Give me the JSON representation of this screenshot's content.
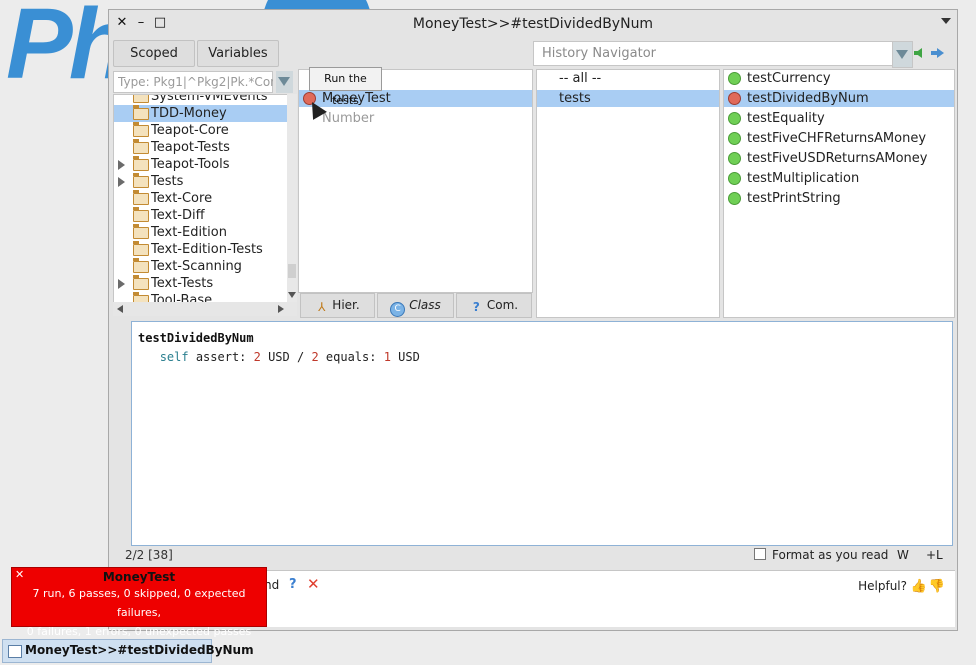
{
  "window": {
    "title": "MoneyTest>>#testDividedByNum"
  },
  "toolbar": {
    "scoped": "Scoped",
    "variables": "Variables",
    "history_placeholder": "History Navigator"
  },
  "package_filter": {
    "placeholder": "Type: Pkg1|^Pkg2|Pk.*Core$"
  },
  "packages": [
    {
      "label": "System-VMEvents",
      "expandable": false,
      "selected": false
    },
    {
      "label": "TDD-Money",
      "expandable": false,
      "selected": true
    },
    {
      "label": "Teapot-Core",
      "expandable": false,
      "selected": false
    },
    {
      "label": "Teapot-Tests",
      "expandable": false,
      "selected": false
    },
    {
      "label": "Teapot-Tools",
      "expandable": true,
      "selected": false
    },
    {
      "label": "Tests",
      "expandable": true,
      "selected": false
    },
    {
      "label": "Text-Core",
      "expandable": false,
      "selected": false
    },
    {
      "label": "Text-Diff",
      "expandable": false,
      "selected": false
    },
    {
      "label": "Text-Edition",
      "expandable": false,
      "selected": false
    },
    {
      "label": "Text-Edition-Tests",
      "expandable": false,
      "selected": false
    },
    {
      "label": "Text-Scanning",
      "expandable": false,
      "selected": false
    },
    {
      "label": "Text-Tests",
      "expandable": true,
      "selected": false
    },
    {
      "label": "Tool-Base",
      "expandable": false,
      "selected": false
    }
  ],
  "classes": [
    {
      "label": "MoneyTest",
      "status": "red",
      "selected": true
    },
    {
      "label": "Number",
      "status": "none",
      "selected": false
    }
  ],
  "tooltip": "Run the tests",
  "class_buttons": {
    "hier": "Hier.",
    "class": "Class",
    "com": "Com."
  },
  "protocols": [
    {
      "label": "-- all --",
      "selected": false
    },
    {
      "label": "tests",
      "selected": true
    }
  ],
  "methods": [
    {
      "label": "testCurrency",
      "status": "green",
      "selected": false
    },
    {
      "label": "testDividedByNum",
      "status": "red",
      "selected": true
    },
    {
      "label": "testEquality",
      "status": "green",
      "selected": false
    },
    {
      "label": "testFiveCHFReturnsAMoney",
      "status": "green",
      "selected": false
    },
    {
      "label": "testFiveUSDReturnsAMoney",
      "status": "green",
      "selected": false
    },
    {
      "label": "testMultiplication",
      "status": "green",
      "selected": false
    },
    {
      "label": "testPrintString",
      "status": "green",
      "selected": false
    }
  ],
  "editor": {
    "method_name": "testDividedByNum",
    "line2": {
      "self": "self",
      "assert": " assert: ",
      "n1": "2",
      "usd1": " USD / ",
      "n2": "2",
      "equals": " equals: ",
      "n3": "1",
      "usd2": " USD"
    }
  },
  "statusbar": {
    "position": "2/2 [38]",
    "format": "Format as you read",
    "w": "W",
    "l": "+L"
  },
  "help": {
    "partial": "nd",
    "question": "?",
    "helpful": "Helpful?"
  },
  "notification": {
    "title": "MoneyTest",
    "line1": "7 run, 6 passes, 0 skipped, 0 expected failures,",
    "line2": "0 failures, 1 errors, 0 unexpected passes"
  },
  "taskbar": {
    "label": "MoneyTest>>#testDividedByNum"
  },
  "colors": {
    "selection": "#a9cdf3",
    "error": "#ee0000",
    "pass": "#6fcf55",
    "fail": "#e06a5a"
  }
}
